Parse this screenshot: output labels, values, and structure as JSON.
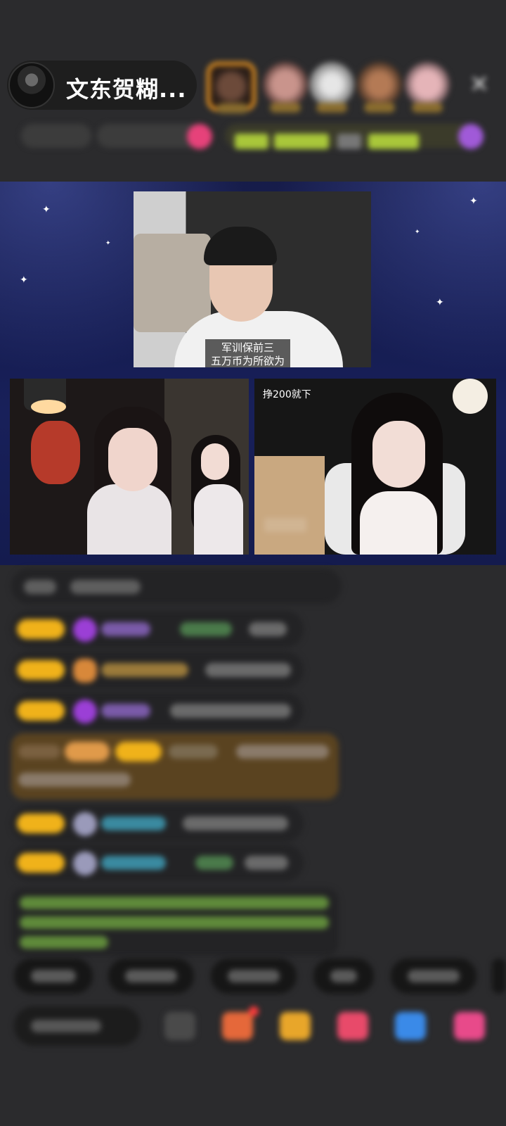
{
  "header": {
    "host_name": "文东贺糊...",
    "close_icon": "close-icon"
  },
  "stage": {
    "top_caption_line1": "军训保前三",
    "top_caption_line2": "五万币为所欲为",
    "right_tile_label": "挣200就下"
  },
  "colors": {
    "background": "#2b2b2d",
    "badge_gold": "#f0b21a",
    "stage_navy": "#18205a",
    "highlight_brown": "#5a4320",
    "system_green": "#8bc34a"
  }
}
